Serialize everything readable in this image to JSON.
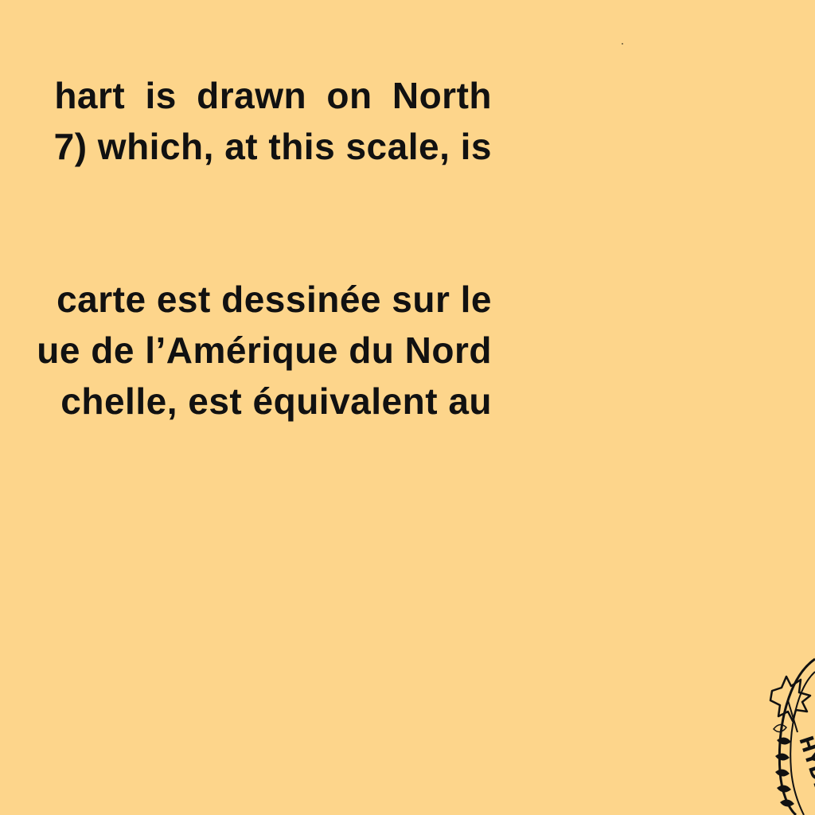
{
  "page": {
    "background_color": "#FDD58B",
    "text_color": "#111111"
  },
  "english": {
    "lines": [
      "hart is drawn on North",
      "7) which, at this scale, is"
    ]
  },
  "french": {
    "lines": [
      "carte est dessinée sur le",
      "ue de l’Amérique du Nord",
      "chelle, est équivalent au"
    ]
  },
  "seal": {
    "icon": "hydrographic-seal-icon",
    "partial_text": "HYDR"
  }
}
